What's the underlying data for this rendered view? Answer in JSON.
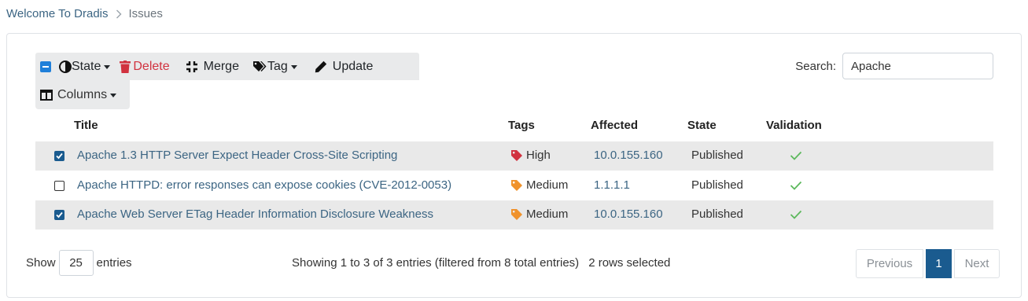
{
  "breadcrumb": {
    "home": "Welcome To Dradis",
    "current": "Issues"
  },
  "toolbar": {
    "state_label": "State",
    "delete_label": "Delete",
    "merge_label": "Merge",
    "tag_label": "Tag",
    "update_label": "Update",
    "columns_label": "Columns"
  },
  "search": {
    "label": "Search:",
    "value": "Apache"
  },
  "table": {
    "headers": {
      "title": "Title",
      "tags": "Tags",
      "affected": "Affected",
      "state": "State",
      "validation": "Validation"
    },
    "rows": [
      {
        "selected": true,
        "title": "Apache 1.3 HTTP Server Expect Header Cross-Site Scripting",
        "tag": "High",
        "tag_color": "#d1323f",
        "affected": "10.0.155.160",
        "state": "Published",
        "validation": "valid"
      },
      {
        "selected": false,
        "title": "Apache HTTPD: error responses can expose cookies (CVE-2012-0053)",
        "tag": "Medium",
        "tag_color": "#f0922b",
        "affected": "1.1.1.1",
        "state": "Published",
        "validation": "valid"
      },
      {
        "selected": true,
        "title": "Apache Web Server ETag Header Information Disclosure Weakness",
        "tag": "Medium",
        "tag_color": "#f0922b",
        "affected": "10.0.155.160",
        "state": "Published",
        "validation": "valid"
      }
    ]
  },
  "footer": {
    "show_label": "Show",
    "page_size": "25",
    "entries_label": "entries",
    "info": "Showing 1 to 3 of 3 entries (filtered from 8 total entries)",
    "selected_info": "2 rows selected",
    "previous": "Previous",
    "current_page": "1",
    "next": "Next"
  },
  "colors": {
    "link": "#3c6583",
    "primary": "#1a5b8f",
    "danger": "#d1323f",
    "warning": "#f0922b",
    "success": "#5cb85c",
    "toolbar_bg": "#e9eaeb",
    "row_shade": "#e9e9e9"
  }
}
